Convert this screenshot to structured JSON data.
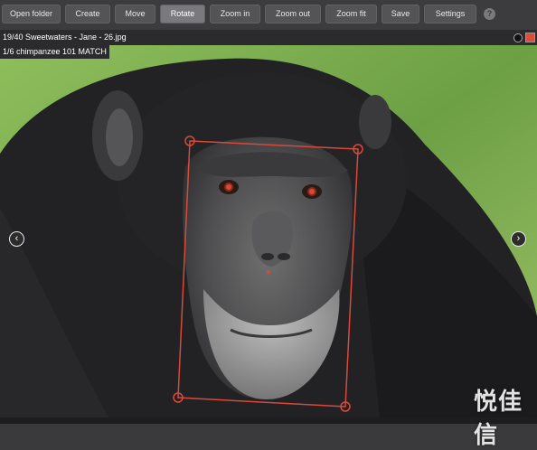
{
  "toolbar": {
    "buttons": [
      {
        "label": "Open folder"
      },
      {
        "label": "Create"
      },
      {
        "label": "Move"
      },
      {
        "label": "Rotate"
      },
      {
        "label": "Zoom in"
      },
      {
        "label": "Zoom out"
      },
      {
        "label": "Zoom fit"
      },
      {
        "label": "Save"
      },
      {
        "label": "Settings"
      }
    ],
    "active_button": "Rotate",
    "help_icon": "help-icon",
    "help_glyph": "?"
  },
  "image_bar": {
    "title": "19/40 Sweetwaters - Jane - 26.jpg",
    "info_icon": "info-icon",
    "color_swatch": "#e04b3c"
  },
  "match": {
    "label": "1/6 chimpanzee 101 MATCH"
  },
  "viewer": {
    "prev_arrow": "chevron-left-icon",
    "next_arrow": "chevron-right-icon",
    "annotation_color": "#d9493a",
    "prev_glyph": "‹",
    "next_glyph": "›"
  },
  "watermark": {
    "text": "悦佳信"
  }
}
